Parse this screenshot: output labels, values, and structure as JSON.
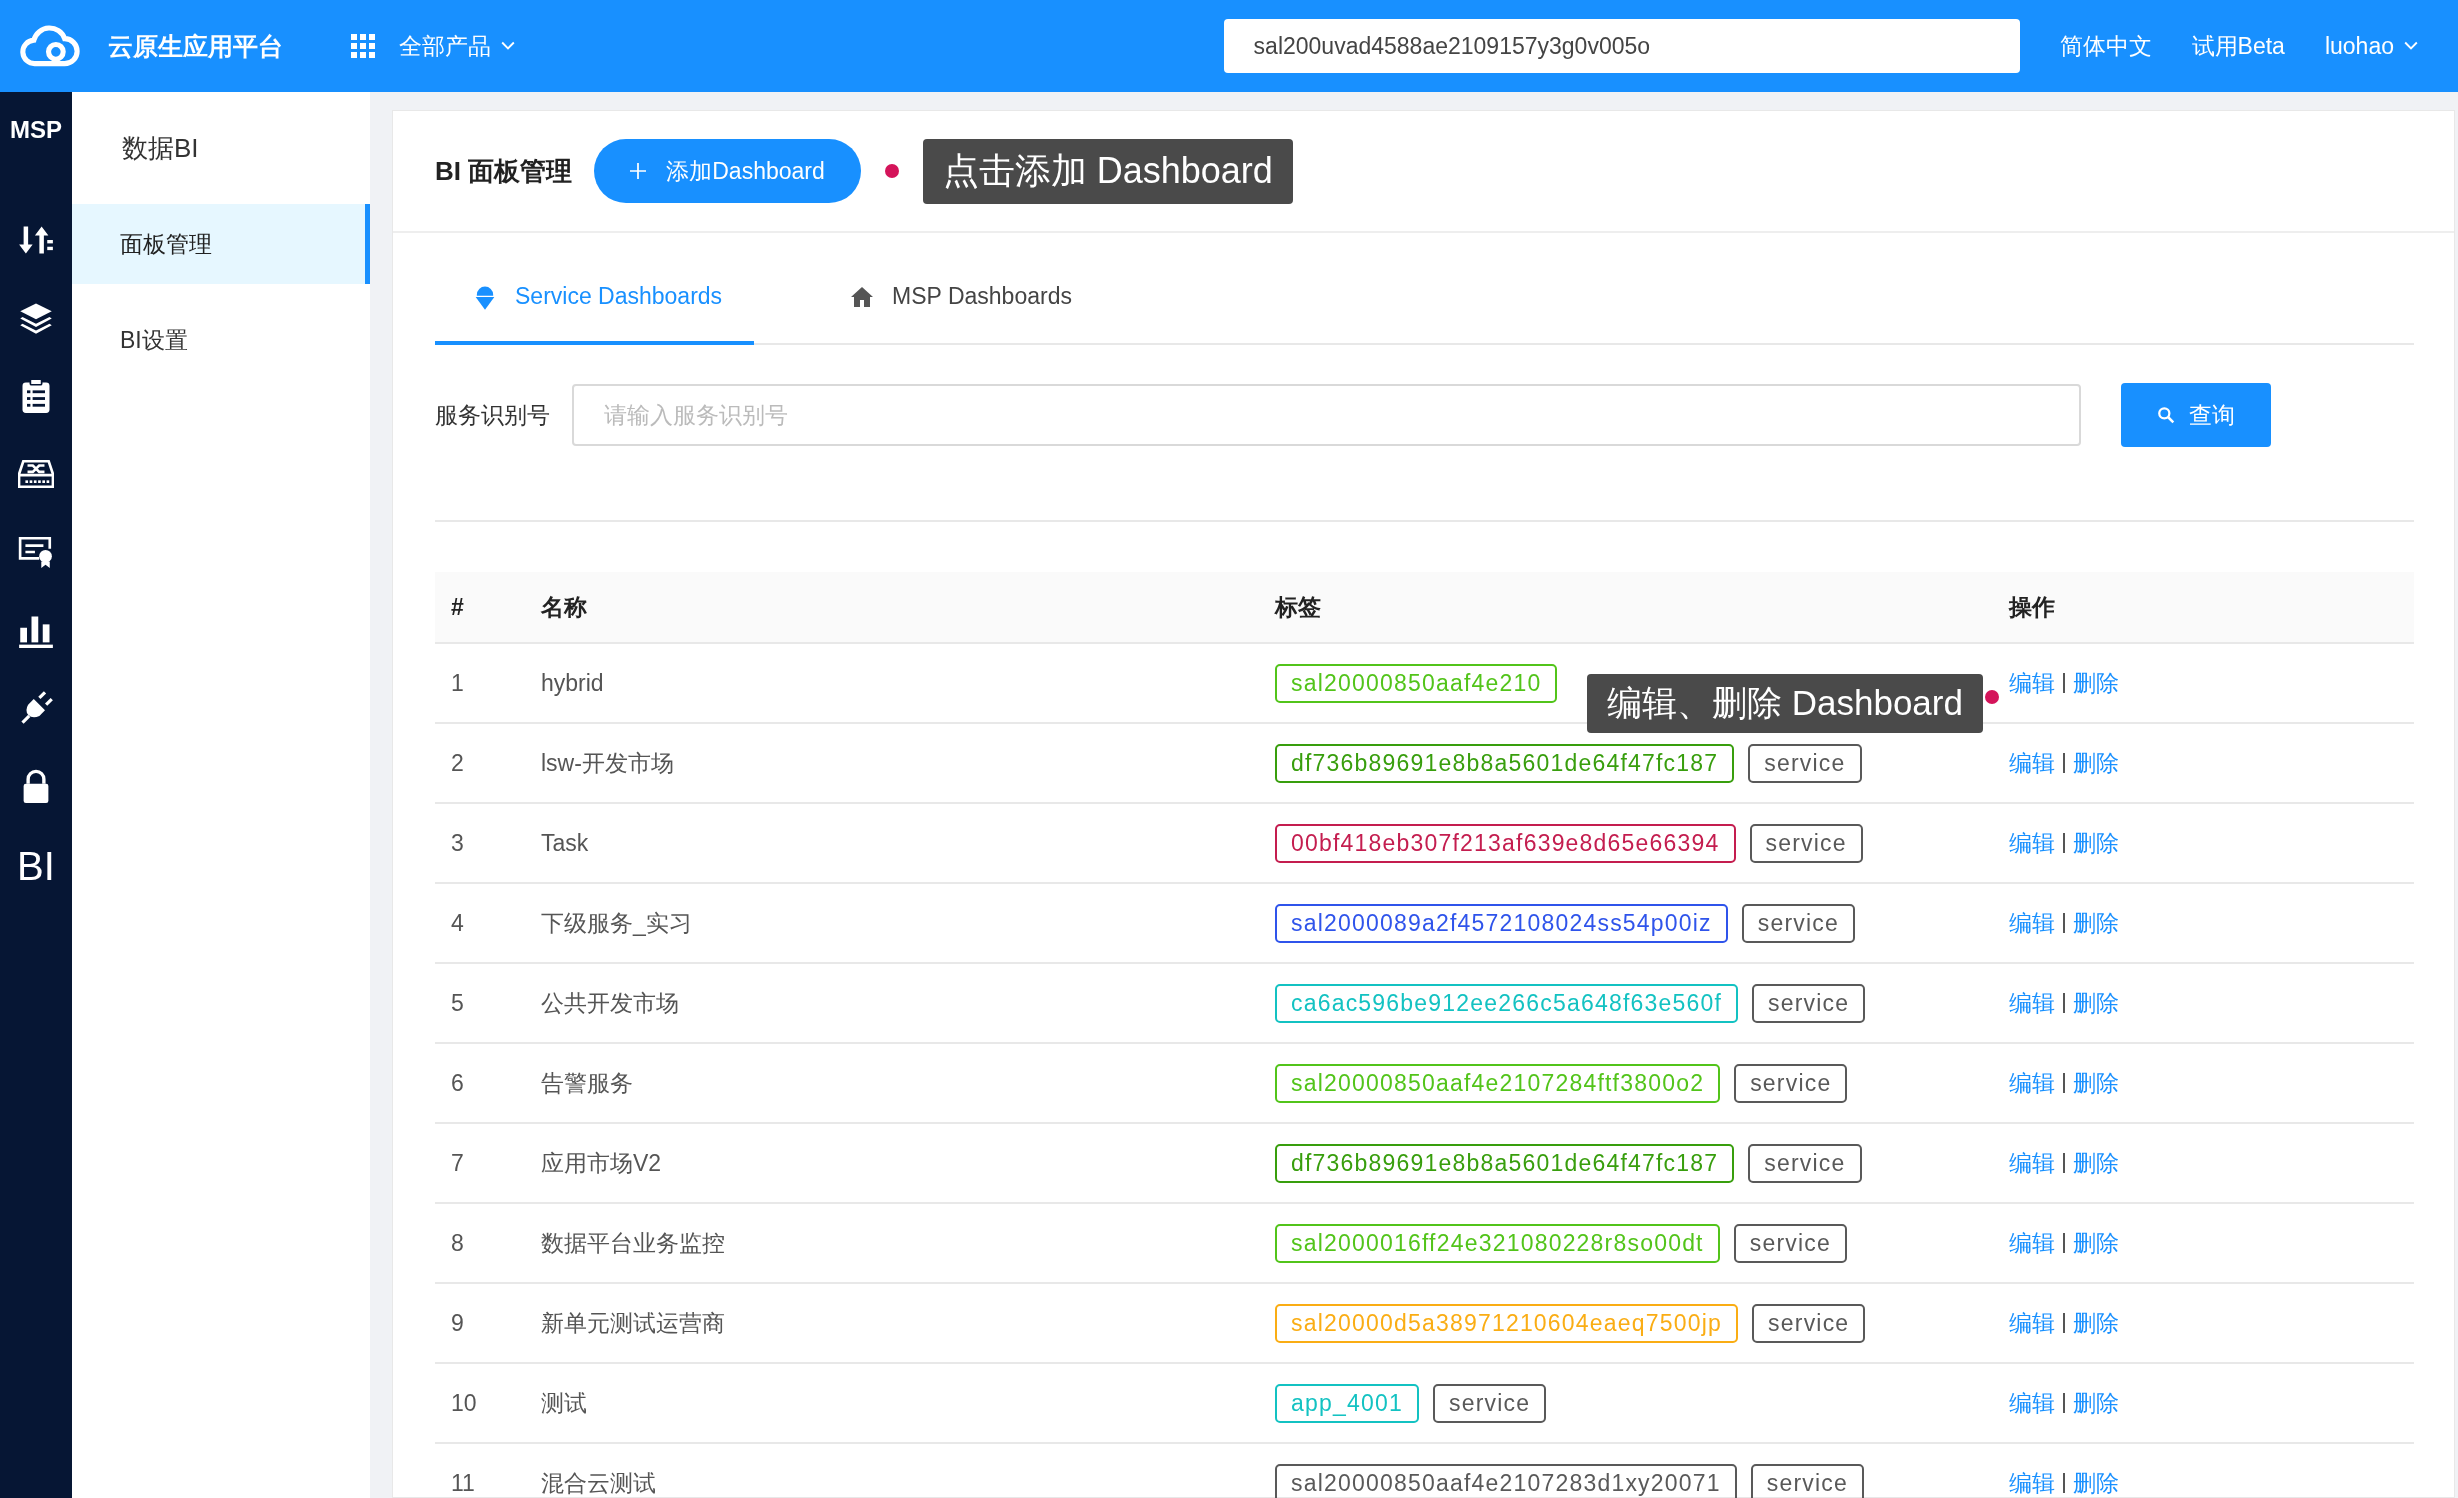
{
  "topbar": {
    "logo_text": "云原生应用平台",
    "products_menu": "全部产品",
    "search_value": "sal200uvad4588ae2109157y3g0v005o",
    "links": [
      "简体中文",
      "试用Beta"
    ],
    "user": "luohao"
  },
  "rail": {
    "title": "MSP",
    "items": [
      {
        "kind": "sort"
      },
      {
        "kind": "layers"
      },
      {
        "kind": "clipboard"
      },
      {
        "kind": "switch"
      },
      {
        "kind": "certificate"
      },
      {
        "kind": "chart"
      },
      {
        "kind": "plug"
      },
      {
        "kind": "lock"
      },
      {
        "kind": "text",
        "label": "BI"
      }
    ]
  },
  "submenu": {
    "title": "数据BI",
    "items": [
      {
        "label": "面板管理",
        "selected": true
      },
      {
        "label": "BI设置",
        "selected": false
      }
    ]
  },
  "page": {
    "title": "BI 面板管理",
    "add_button": "添加Dashboard",
    "hint": "点击添加 Dashboard"
  },
  "tabs": [
    {
      "label": "Service Dashboards",
      "kind": "service",
      "selected": true
    },
    {
      "label": "MSP Dashboards",
      "kind": "home",
      "selected": false
    }
  ],
  "filter": {
    "label": "服务识别号",
    "placeholder": "请输入服务识别号",
    "button": "查询"
  },
  "table": {
    "columns": [
      "#",
      "名称",
      "标签",
      "操作"
    ],
    "rows": [
      {
        "index": "1",
        "name": "hybrid",
        "tags": [
          {
            "text": "sal20000850aaf4e210",
            "color": "#52c41a"
          }
        ],
        "actions": [
          "编辑",
          "删除"
        ],
        "hint": "编辑、删除 Dashboard"
      },
      {
        "index": "2",
        "name": "lsw-开发市场",
        "tags": [
          {
            "text": "df736b89691e8b8a5601de64f47fc187",
            "color": "#389e0d"
          },
          {
            "text": "service",
            "color": "#595959"
          }
        ],
        "actions": [
          "编辑",
          "删除"
        ]
      },
      {
        "index": "3",
        "name": "Task",
        "tags": [
          {
            "text": "00bf418eb307f213af639e8d65e66394",
            "color": "#c41d4f"
          },
          {
            "text": "service",
            "color": "#595959"
          }
        ],
        "actions": [
          "编辑",
          "删除"
        ]
      },
      {
        "index": "4",
        "name": "下级服务_实习",
        "tags": [
          {
            "text": "sal2000089a2f4572108024ss54p00iz",
            "color": "#2f54eb"
          },
          {
            "text": "service",
            "color": "#595959"
          }
        ],
        "actions": [
          "编辑",
          "删除"
        ]
      },
      {
        "index": "5",
        "name": "公共开发市场",
        "tags": [
          {
            "text": "ca6ac596be912ee266c5a648f63e560f",
            "color": "#13c2c2"
          },
          {
            "text": "service",
            "color": "#595959"
          }
        ],
        "actions": [
          "编辑",
          "删除"
        ]
      },
      {
        "index": "6",
        "name": "告警服务",
        "tags": [
          {
            "text": "sal20000850aaf4e2107284ftf3800o2",
            "color": "#52c41a"
          },
          {
            "text": "service",
            "color": "#595959"
          }
        ],
        "actions": [
          "编辑",
          "删除"
        ]
      },
      {
        "index": "7",
        "name": "应用市场V2",
        "tags": [
          {
            "text": "df736b89691e8b8a5601de64f47fc187",
            "color": "#389e0d"
          },
          {
            "text": "service",
            "color": "#595959"
          }
        ],
        "actions": [
          "编辑",
          "删除"
        ]
      },
      {
        "index": "8",
        "name": "数据平台业务监控",
        "tags": [
          {
            "text": "sal2000016ff24e321080228r8so00dt",
            "color": "#52c41a"
          },
          {
            "text": "service",
            "color": "#595959"
          }
        ],
        "actions": [
          "编辑",
          "删除"
        ]
      },
      {
        "index": "9",
        "name": "新单元测试运营商",
        "tags": [
          {
            "text": "sal20000d5a38971210604eaeq7500jp",
            "color": "#faad14"
          },
          {
            "text": "service",
            "color": "#595959"
          }
        ],
        "actions": [
          "编辑",
          "删除"
        ]
      },
      {
        "index": "10",
        "name": "测试",
        "tags": [
          {
            "text": "app_4001",
            "color": "#13c2c2"
          },
          {
            "text": "service",
            "color": "#595959"
          }
        ],
        "actions": [
          "编辑",
          "删除"
        ]
      },
      {
        "index": "11",
        "name": "混合云测试",
        "tags": [
          {
            "text": "sal20000850aaf4e2107283d1xy20071",
            "color": "#595959"
          },
          {
            "text": "service",
            "color": "#595959"
          }
        ],
        "actions": [
          "编辑",
          "删除"
        ]
      }
    ]
  }
}
